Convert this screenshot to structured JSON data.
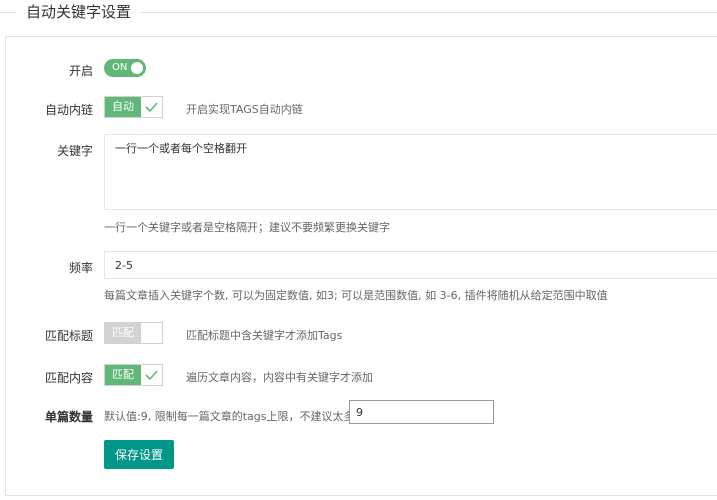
{
  "section_title": "自动关键字设置",
  "enable": {
    "label": "开启",
    "switch_text": "ON"
  },
  "auto_link": {
    "label": "自动内链",
    "checkbox_text": "自动",
    "hint": "开启实现TAGS自动内链"
  },
  "keywords": {
    "label": "关键字",
    "value": "一行一个或者每个空格翻开",
    "hint": "一行一个关键字或者是空格隔开；建议不要频繁更换关键字"
  },
  "frequency": {
    "label": "频率",
    "value": "2-5",
    "hint": "每篇文章插入关键字个数, 可以为固定数值, 如3; 可以是范围数值, 如 3-6, 插件将随机从给定范围中取值"
  },
  "match_title": {
    "label": "匹配标题",
    "checkbox_text": "匹配",
    "hint": "匹配标题中含关键字才添加Tags"
  },
  "match_content": {
    "label": "匹配内容",
    "checkbox_text": "匹配",
    "hint": "遍历文章内容，内容中有关键字才添加"
  },
  "single_count": {
    "label": "单篇数量",
    "hint": "默认值:9, 限制每一篇文章的tags上限，不建议太多",
    "value": "9"
  },
  "save_button": "保存设置",
  "colors": {
    "green": "#5fb878",
    "teal": "#009688",
    "gray": "#d2d2d2"
  }
}
